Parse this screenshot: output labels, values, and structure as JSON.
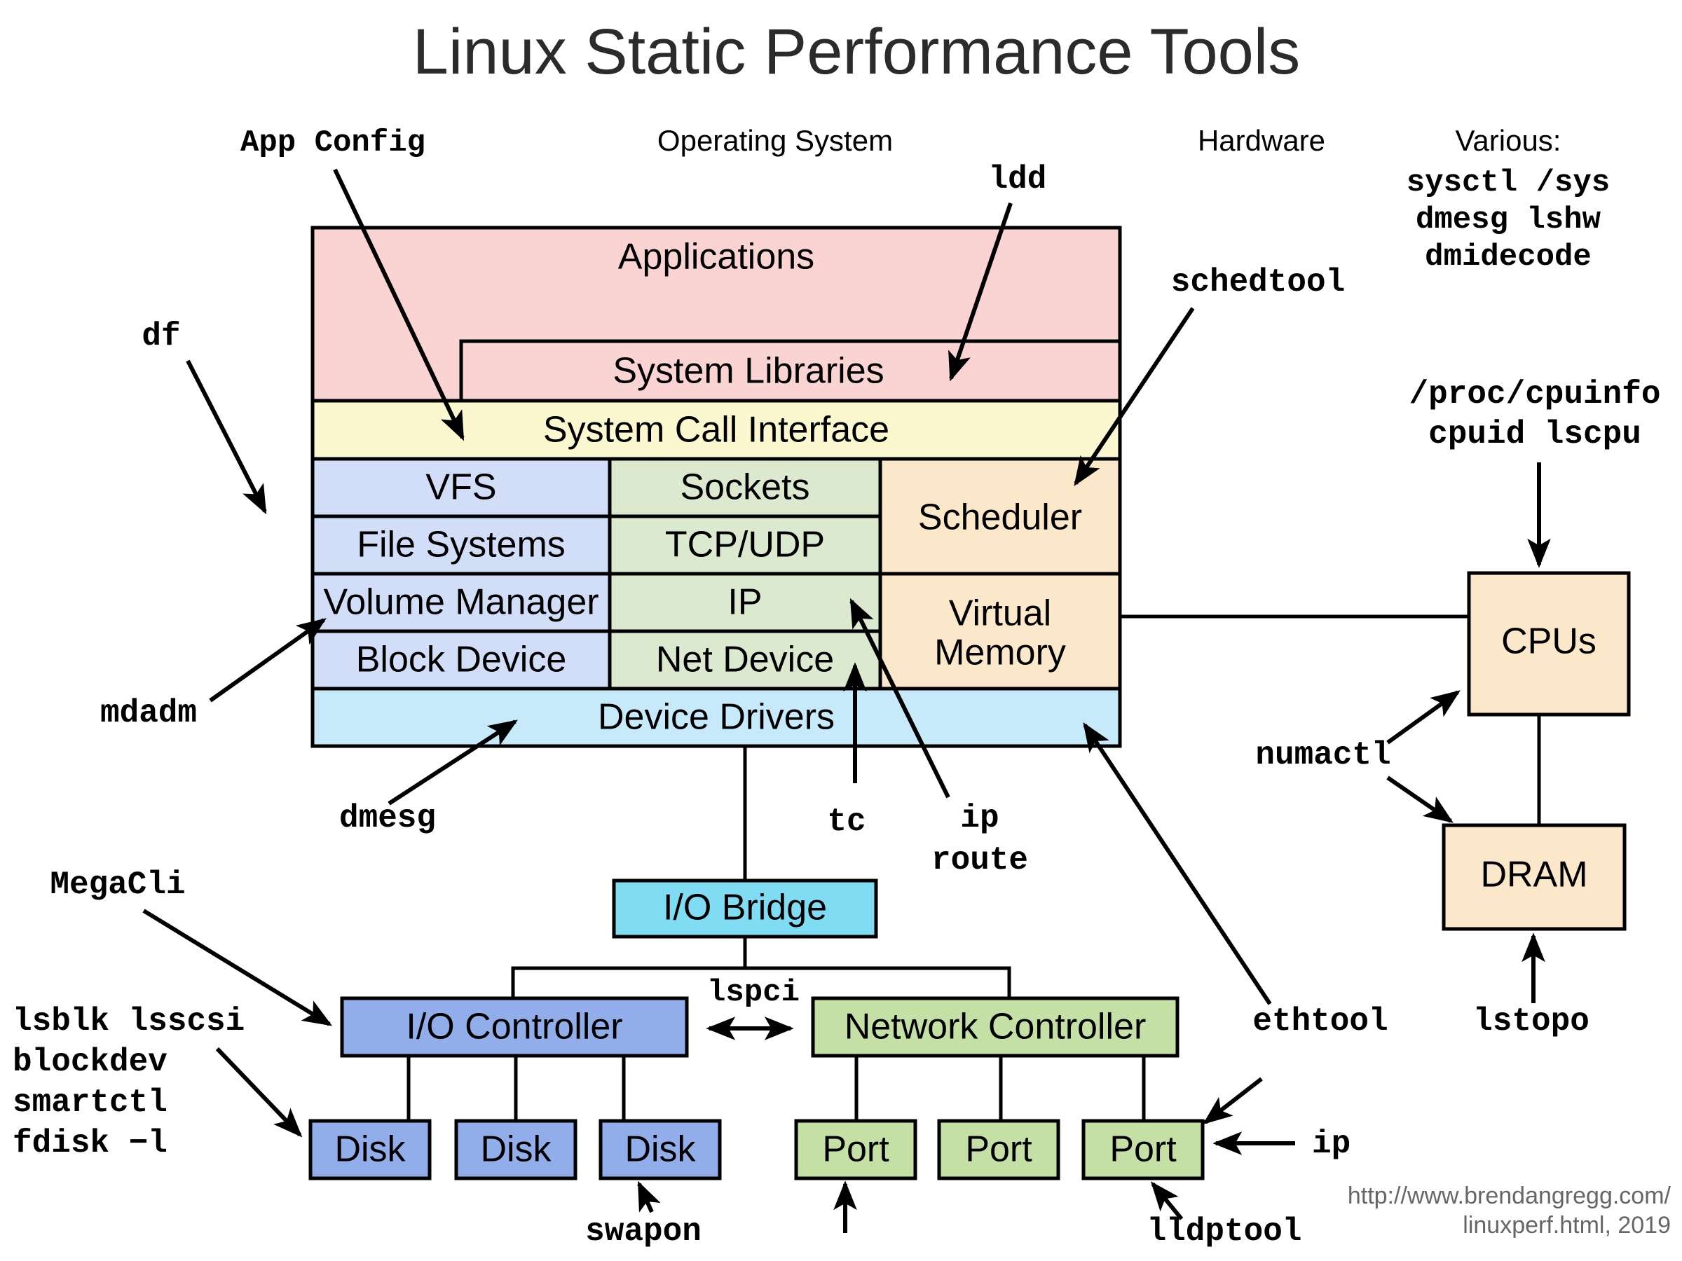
{
  "title": "Linux Static Performance Tools",
  "headers": {
    "app_config": "App Config",
    "operating_system": "Operating System",
    "hardware": "Hardware",
    "various_label": "Various:"
  },
  "stack": {
    "applications": "Applications",
    "system_libraries": "System Libraries",
    "system_call_interface": "System Call Interface",
    "vfs": "VFS",
    "file_systems": "File Systems",
    "volume_manager": "Volume Manager",
    "block_device": "Block Device",
    "sockets": "Sockets",
    "tcp_udp": "TCP/UDP",
    "ip": "IP",
    "net_device": "Net Device",
    "scheduler": "Scheduler",
    "virtual_memory_line1": "Virtual",
    "virtual_memory_line2": "Memory",
    "device_drivers": "Device Drivers"
  },
  "hardware_boxes": {
    "cpus": "CPUs",
    "dram": "DRAM",
    "io_bridge": "I/O Bridge",
    "io_controller": "I/O Controller",
    "network_controller": "Network Controller",
    "disk1": "Disk",
    "disk2": "Disk",
    "disk3": "Disk",
    "port1": "Port",
    "port2": "Port",
    "port3": "Port"
  },
  "tools": {
    "ldd": "ldd",
    "schedtool": "schedtool",
    "df": "df",
    "mdadm": "mdadm",
    "dmesg": "dmesg",
    "tc": "tc",
    "ip_route_line1": "ip",
    "ip_route_line2": "route",
    "megacli": "MegaCli",
    "lspci": "lspci",
    "ethtool": "ethtool",
    "ip": "ip",
    "swapon": "swapon",
    "lldptool": "lldptool",
    "lstopo": "lstopo",
    "numactl": "numactl",
    "block_tools_line1": "lsblk lsscsi",
    "block_tools_line2": "blockdev",
    "block_tools_line3": "smartctl",
    "block_tools_line4": "fdisk −l",
    "various_line1": "sysctl /sys",
    "various_line2": "dmesg lshw",
    "various_line3": "dmidecode",
    "cpuinfo_line1": "/proc/cpuinfo",
    "cpuinfo_line2": "cpuid lscpu"
  },
  "footer": {
    "line1": "http://www.brendangregg.com/",
    "line2": "linuxperf.html, 2019"
  },
  "colors": {
    "pink": "#fad3d3",
    "cream": "#fbf8d0",
    "blue": "#d2def7",
    "green": "#dbe9cf",
    "orange": "#fbe7c9",
    "cyan_light": "#c6eafa",
    "cyan": "#7fdcf2",
    "blue_mid": "#92aeea",
    "green_mid": "#c4e0a4",
    "stroke": "#000000",
    "footer_gray": "#666666"
  }
}
